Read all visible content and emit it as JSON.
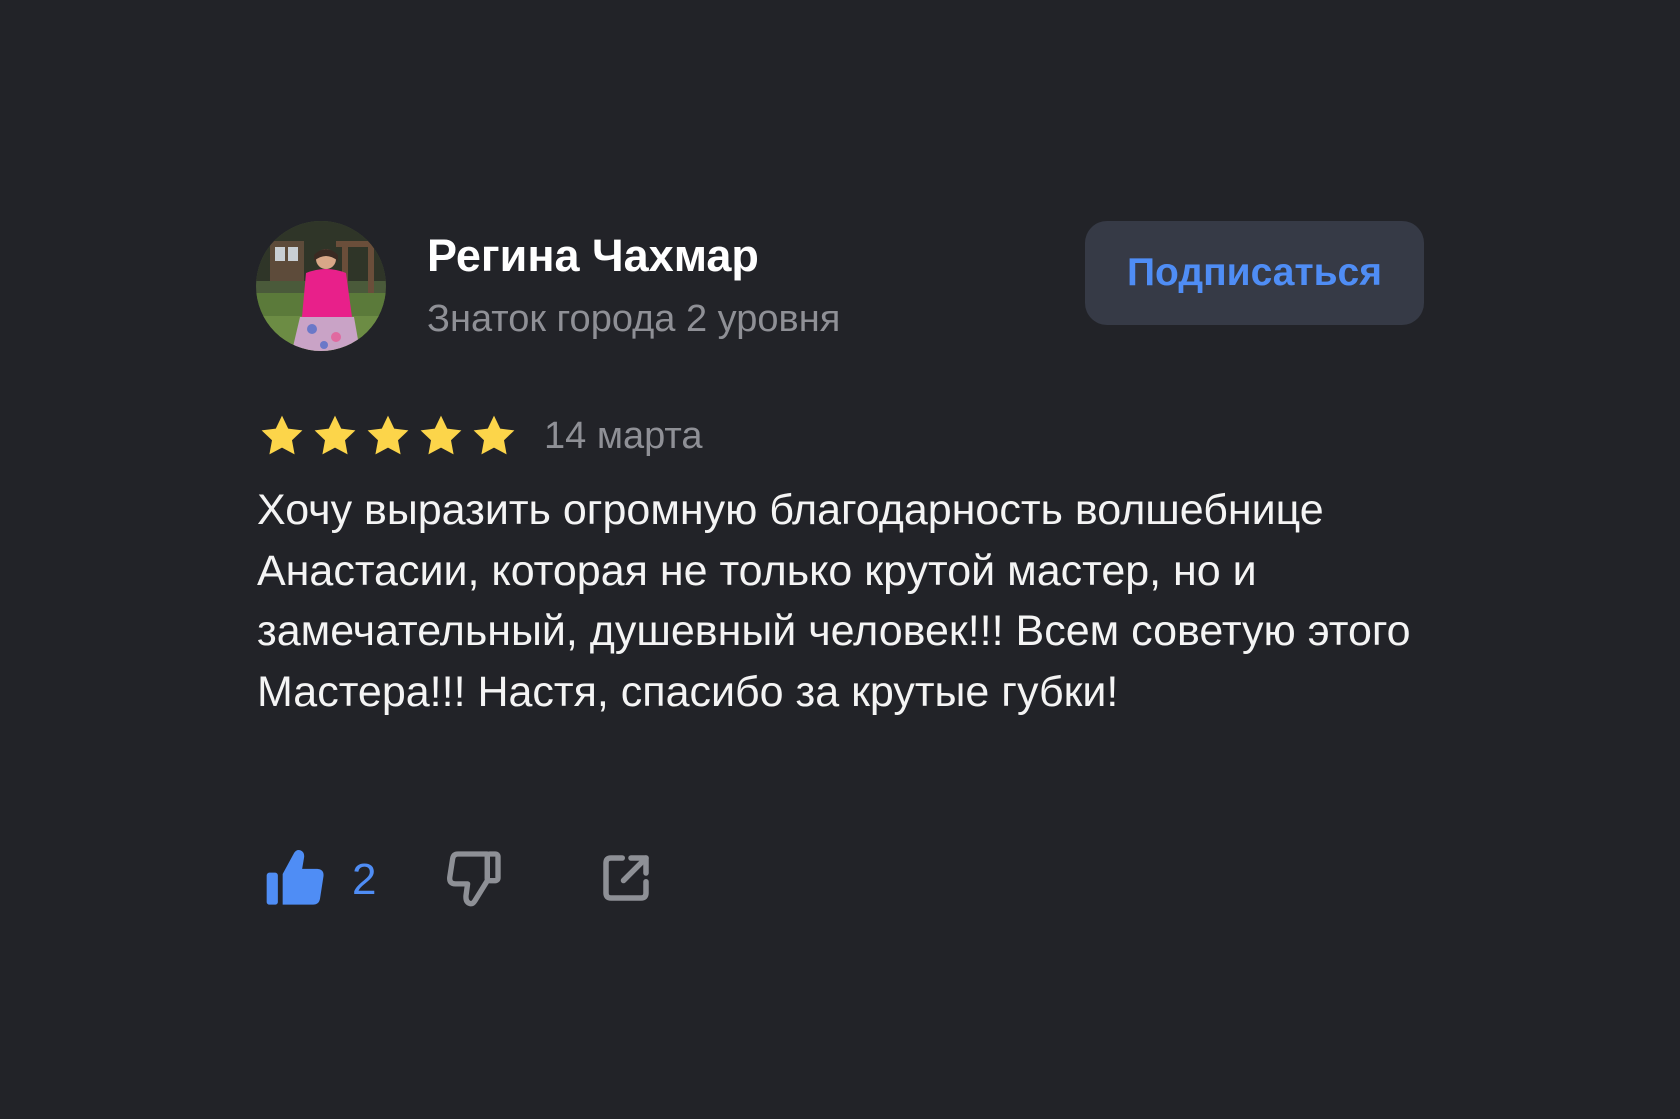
{
  "review": {
    "author": {
      "name": "Регина Чахмар",
      "level": "Знаток города 2 уровня",
      "avatar_icon": "user-photo-avatar"
    },
    "subscribe_label": "Подписаться",
    "rating": 5,
    "rating_max": 5,
    "date": "14 марта",
    "text": "Хочу выразить огромную благодарность волшебнице Анастасии, которая не только крутой мастер, но и замечательный, душевный человек!!! Всем советую этого Мастера!!! Настя, спасибо за крутые губки!",
    "likes_count": "2",
    "icons": {
      "like": "thumbs-up-icon",
      "dislike": "thumbs-down-icon",
      "share": "share-icon",
      "star": "star-icon"
    }
  },
  "colors": {
    "background": "#222328",
    "accent": "#4f8df5",
    "star": "#fcd54a",
    "secondary_text": "#8f9096",
    "button_bg": "#363a46",
    "icon_gray": "#8e9096"
  }
}
